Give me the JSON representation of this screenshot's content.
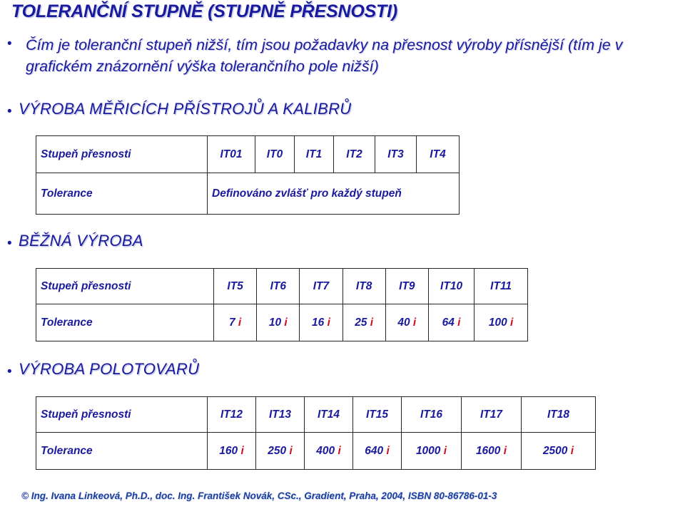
{
  "slide": {
    "title": "TOLERANČNÍ STUPNĚ (STUPNĚ PŘESNOSTI)",
    "lead_bullet": "Čím je toleranční stupeň nižší, tím jsou požadavky na přesnost výroby přísnější (tím je v grafickém znázornění výška tolerančního pole nižší)",
    "footer": "© Ing. Ivana Linkeová, Ph.D., doc. Ing. František Novák, CSc., Gradient, Praha, 2004, ISBN 80-86786-01-3",
    "bullet_glyph": "•"
  },
  "colors": {
    "text_blue": "#1a1a9e",
    "accent_red": "#cc1122",
    "border": "#262626",
    "background": "#ffffff"
  },
  "sections": [
    {
      "heading": "VÝROBA MĚŘICÍCH PŘÍSTROJŮ A KALIBRŮ",
      "table": {
        "row_labels": [
          "Stupeň přesnosti",
          "Tolerance"
        ],
        "grades": [
          "IT01",
          "IT0",
          "IT1",
          "IT2",
          "IT3",
          "IT4"
        ],
        "tolerance_merged": "Definováno zvlášť pro každý stupeň",
        "tolerances": []
      }
    },
    {
      "heading": "BĚŽNÁ VÝROBA",
      "table": {
        "row_labels": [
          "Stupeň přesnosti",
          "Tolerance"
        ],
        "grades": [
          "IT5",
          "IT6",
          "IT7",
          "IT8",
          "IT9",
          "IT10",
          "IT11"
        ],
        "tolerance_merged": "",
        "tolerances": [
          {
            "value": "7",
            "unit": "i"
          },
          {
            "value": "10",
            "unit": "i"
          },
          {
            "value": "16",
            "unit": "i"
          },
          {
            "value": "25",
            "unit": "i"
          },
          {
            "value": "40",
            "unit": "i"
          },
          {
            "value": "64",
            "unit": "i"
          },
          {
            "value": "100",
            "unit": "i"
          }
        ]
      }
    },
    {
      "heading": "VÝROBA POLOTOVARŮ",
      "table": {
        "row_labels": [
          "Stupeň přesnosti",
          "Tolerance"
        ],
        "grades": [
          "IT12",
          "IT13",
          "IT14",
          "IT15",
          "IT16",
          "IT17",
          "IT18"
        ],
        "tolerance_merged": "",
        "tolerances": [
          {
            "value": "160",
            "unit": "i"
          },
          {
            "value": "250",
            "unit": "i"
          },
          {
            "value": "400",
            "unit": "i"
          },
          {
            "value": "640",
            "unit": "i"
          },
          {
            "value": "1000",
            "unit": "i"
          },
          {
            "value": "1600",
            "unit": "i"
          },
          {
            "value": "2500",
            "unit": "i"
          }
        ]
      }
    }
  ]
}
